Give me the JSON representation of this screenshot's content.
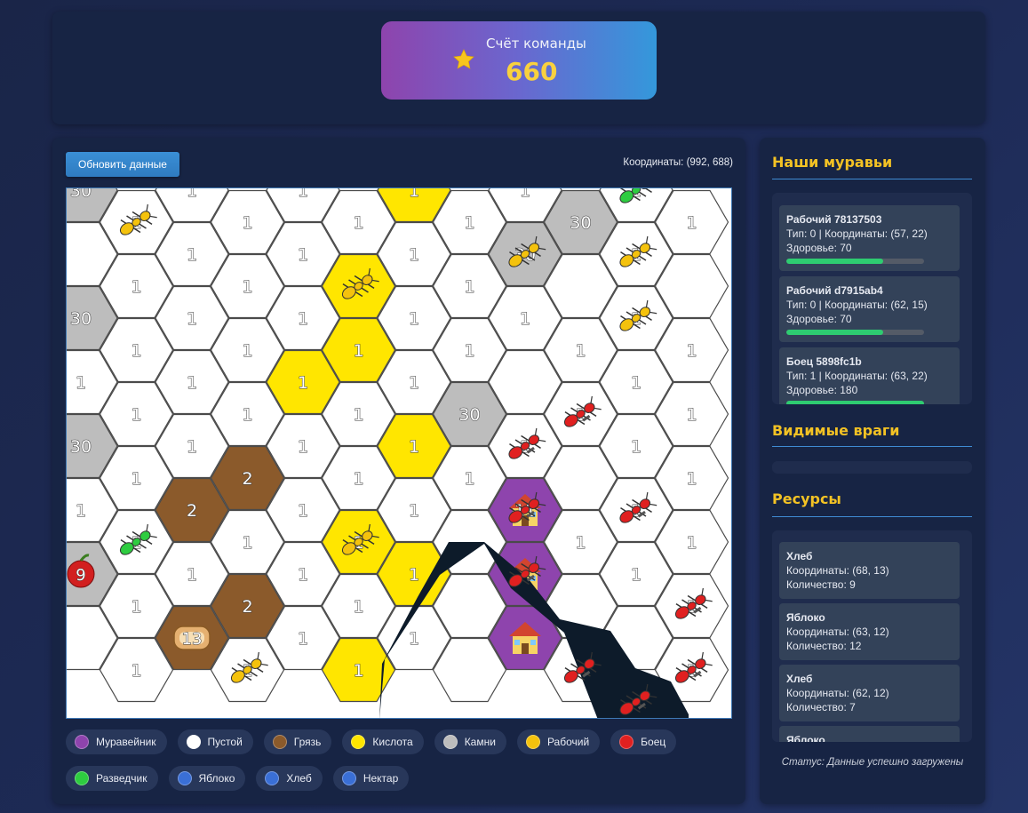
{
  "score": {
    "label": "Счёт команды",
    "value": "660"
  },
  "toolbar": {
    "refresh_label": "Обновить данные",
    "coords_text": "Координаты: (992, 688)"
  },
  "colors": {
    "anthill": "#8e44ad",
    "empty": "#ffffff",
    "dirt": "#8b5a2b",
    "acid": "#ffe600",
    "stones": "#bdbdbd",
    "fog": "#0d1b2a",
    "worker": "#f4c20d",
    "fighter": "#e02020",
    "scout": "#2ecc40"
  },
  "map": {
    "hex_rows": [
      [
        "stones:30",
        "empty:1",
        "empty:1",
        "empty:1",
        "empty:1",
        "empty:1",
        "acid:1",
        "empty:1",
        "empty:1",
        "stones:30",
        "empty:1",
        "empty:1"
      ],
      [
        "empty:",
        "empty:1",
        "empty:1",
        "empty:1",
        "empty:1",
        "acid:",
        "empty:1",
        "empty:1",
        "stones:30",
        "empty:",
        "empty:1",
        "empty:"
      ],
      [
        "stones:30",
        "empty:1",
        "empty:1",
        "empty:1",
        "empty:1",
        "acid:1",
        "empty:1",
        "empty:1",
        "empty:1",
        "empty:1",
        "empty:1",
        "empty:1"
      ],
      [
        "empty:1",
        "empty:1",
        "empty:1",
        "empty:1",
        "acid:1",
        "empty:1",
        "empty:1",
        "stones:30",
        "empty:",
        "empty:1",
        "empty:1",
        "empty:1"
      ],
      [
        "stones:30",
        "empty:1",
        "empty:1",
        "dirt:2",
        "empty:1",
        "empty:1",
        "acid:1",
        "empty:1",
        "empty:1",
        "empty:",
        "empty:1",
        "empty:1"
      ],
      [
        "empty:1",
        "empty:1",
        "dirt:2",
        "empty:1",
        "empty:1",
        "acid:1",
        "empty:1",
        "empty:",
        "anthill:11",
        "empty:1",
        "empty:1",
        "empty:1"
      ],
      [
        "stones:30",
        "empty:1",
        "empty:1",
        "dirt:2",
        "empty:1",
        "empty:1",
        "acid:1",
        "empty:",
        "anthill:",
        "empty:",
        "empty:1",
        "empty:1"
      ],
      [
        "empty:",
        "empty:1",
        "dirt:2",
        "empty:1",
        "empty:1",
        "acid:1",
        "empty:1",
        "empty:",
        "anthill:",
        "empty:",
        "empty:",
        "empty:1"
      ]
    ],
    "units": [
      {
        "kind": "worker",
        "r": 0,
        "c": 1
      },
      {
        "kind": "scout",
        "r": 0,
        "c": 10
      },
      {
        "kind": "worker",
        "r": 1,
        "c": 5
      },
      {
        "kind": "worker",
        "r": 1,
        "c": 8
      },
      {
        "kind": "worker",
        "r": 1,
        "c": 10
      },
      {
        "kind": "worker",
        "r": 2,
        "c": 10
      },
      {
        "kind": "fighter",
        "r": 3,
        "c": 9
      },
      {
        "kind": "fighter",
        "r": 4,
        "c": 8
      },
      {
        "kind": "fighter",
        "r": 5,
        "c": 8
      },
      {
        "kind": "fighter",
        "r": 5,
        "c": 10
      },
      {
        "kind": "fighter",
        "r": 6,
        "c": 11
      },
      {
        "kind": "fighter",
        "r": 6,
        "c": 8
      },
      {
        "kind": "fighter",
        "r": 7,
        "c": 9
      },
      {
        "kind": "fighter",
        "r": 7,
        "c": 11
      },
      {
        "kind": "fighter",
        "r": 8,
        "c": 10
      },
      {
        "kind": "scout",
        "r": 5,
        "c": 1
      },
      {
        "kind": "worker",
        "r": 5,
        "c": 5
      },
      {
        "kind": "worker",
        "r": 7,
        "c": 3
      }
    ],
    "resources": [
      {
        "kind": "apple",
        "label": "9",
        "r": 6,
        "c": 0
      },
      {
        "kind": "bread",
        "label": "13",
        "r": 7,
        "c": 2
      }
    ]
  },
  "legend": [
    {
      "name": "anthill",
      "label": "Муравейник",
      "color": "#8e44ad",
      "glyph": "⌂"
    },
    {
      "name": "empty",
      "label": "Пустой",
      "color": "#ffffff",
      "glyph": ""
    },
    {
      "name": "dirt",
      "label": "Грязь",
      "color": "#8b5a2b",
      "glyph": ""
    },
    {
      "name": "acid",
      "label": "Кислота",
      "color": "#ffe600",
      "glyph": ""
    },
    {
      "name": "stones",
      "label": "Камни",
      "color": "#bdbdbd",
      "glyph": ""
    },
    {
      "name": "worker",
      "label": "Рабочий",
      "color": "#f4c20d",
      "glyph": "✱"
    },
    {
      "name": "fighter",
      "label": "Боец",
      "color": "#e02020",
      "glyph": "✱"
    },
    {
      "name": "scout",
      "label": "Разведчик",
      "color": "#2ecc40",
      "glyph": "✱"
    },
    {
      "name": "apple",
      "label": "Яблоко",
      "color": "#3a6fd6",
      "glyph": "●"
    },
    {
      "name": "bread",
      "label": "Хлеб",
      "color": "#3a6fd6",
      "glyph": "▬"
    },
    {
      "name": "nectar",
      "label": "Нектар",
      "color": "#3a6fd6",
      "glyph": "◆"
    }
  ],
  "sidebar": {
    "ants_title": "Наши муравьи",
    "ants": [
      {
        "title": "Рабочий 78137503",
        "info": "Тип: 0 | Координаты: (57, 22)",
        "health_text": "Здоровье: 70",
        "health_fraction": 0.7
      },
      {
        "title": "Рабочий d7915ab4",
        "info": "Тип: 0 | Координаты: (62, 15)",
        "health_text": "Здоровье: 70",
        "health_fraction": 0.7
      },
      {
        "title": "Боец 5898fc1b",
        "info": "Тип: 1 | Координаты: (63, 22)",
        "health_text": "Здоровье: 180",
        "health_fraction": 1.0
      }
    ],
    "enemies_title": "Видимые враги",
    "resources_title": "Ресурсы",
    "resources": [
      {
        "title": "Хлеб",
        "coords": "Координаты: (68, 13)",
        "amount": "Количество: 9"
      },
      {
        "title": "Яблоко",
        "coords": "Координаты: (63, 12)",
        "amount": "Количество: 12"
      },
      {
        "title": "Хлеб",
        "coords": "Координаты: (62, 12)",
        "amount": "Количество: 7"
      },
      {
        "title": "Яблоко",
        "coords": "",
        "amount": ""
      }
    ],
    "status": "Статус: Данные успешно загружены"
  }
}
